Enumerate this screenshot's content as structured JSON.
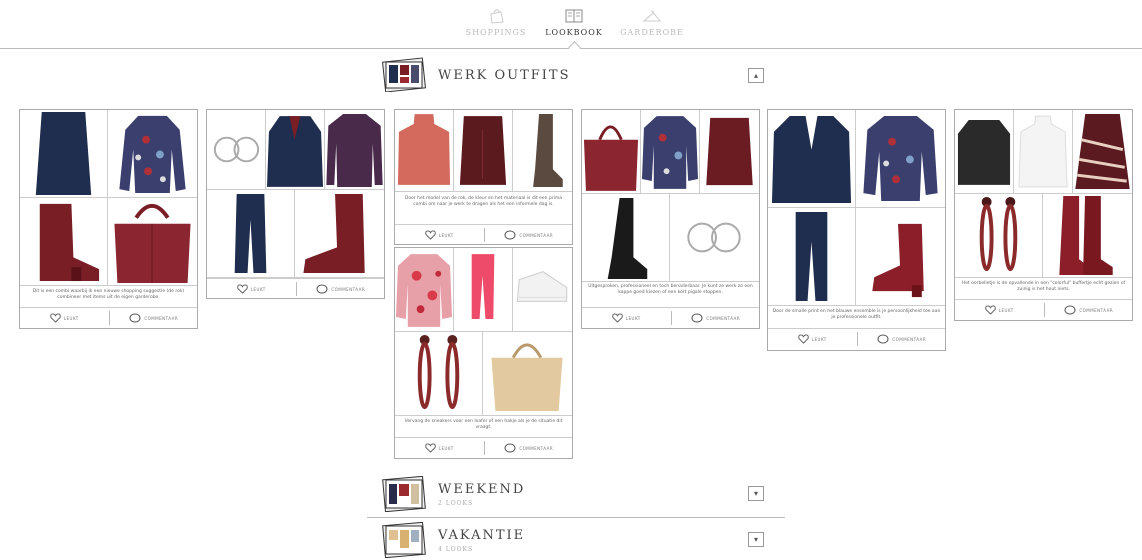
{
  "nav": {
    "tabs": [
      {
        "label": "SHOPPINGS",
        "icon": "shopping-bag-icon",
        "active": false
      },
      {
        "label": "LOOKBOOK",
        "icon": "lookbook-icon",
        "active": true
      },
      {
        "label": "GARDEROBE",
        "icon": "hanger-icon",
        "active": false
      }
    ]
  },
  "sections": [
    {
      "title": "WERK OUTFITS",
      "subtitle": "",
      "toggle": "▴",
      "expanded": true
    },
    {
      "title": "WEEKEND",
      "subtitle": "2 LOOKS",
      "toggle": "▾",
      "expanded": false
    },
    {
      "title": "VAKANTIE",
      "subtitle": "4 LOOKS",
      "toggle": "▾",
      "expanded": false
    }
  ],
  "actions": {
    "like": "LEUKT",
    "comment": "COMMENTAAR"
  },
  "outfits": [
    {
      "caption": "Dit is een combi waarbij ik een nieuwe shopping suggestie (de rok) combineer met items uit de eigen garderobe."
    },
    {
      "caption": ""
    },
    {
      "caption": "Door het model van de rok, de kleur en het materiaal is dit een prima combi om naar je werk te dragen als het een informele dag is."
    },
    {
      "caption": "Vervang de sneakers voor een loafer of een hakje als je de situatie dit vraagt."
    },
    {
      "caption": "Uitgesproken, professioneel en toch benaderbaar. Je kunt ze werk zo een kappe goed kiezen of een kort pigale stoppen."
    },
    {
      "caption": "Door de smalle print en het blauwe ensemble is je persoonlijkheid toe aan je professionele outfit."
    },
    {
      "caption": "Het oorbelletje is de opvallende in een \"colorful\" buffertje echt gezien of zuinig is het hout niets."
    }
  ],
  "colors": {
    "burgundy": "#7a1e25",
    "navy": "#1f2d4e",
    "text": "#444444",
    "line": "#bbbbbb"
  }
}
